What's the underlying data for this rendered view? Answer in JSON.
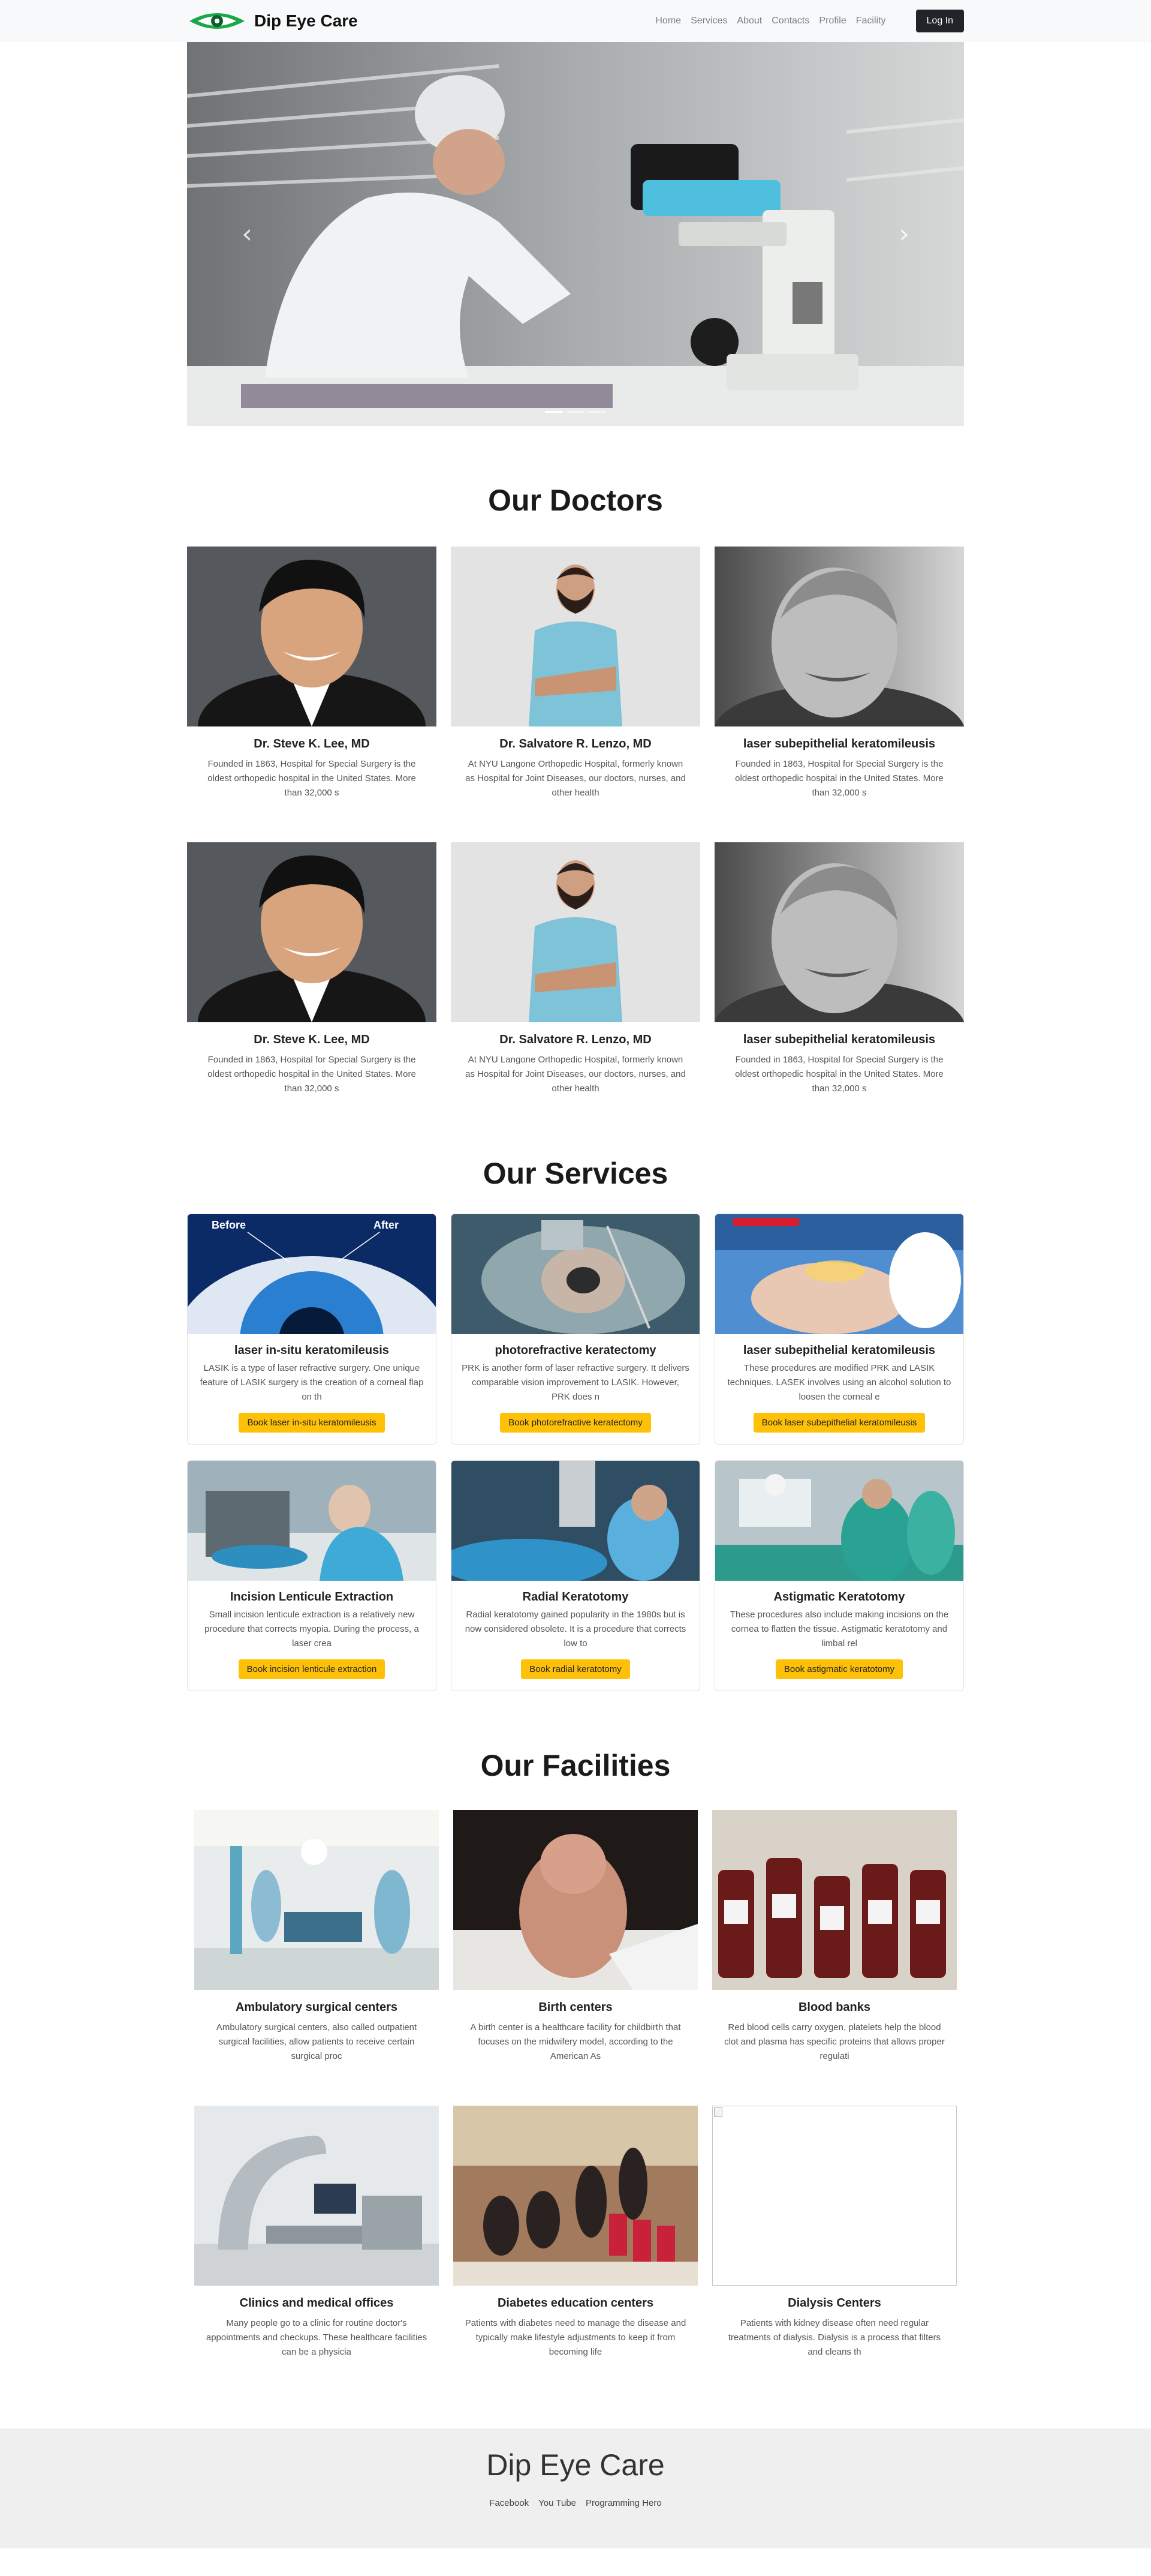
{
  "navbar": {
    "brand": "Dip Eye Care",
    "links": [
      "Home",
      "Services",
      "About",
      "Contacts",
      "Profile",
      "Facility"
    ],
    "login": "Log In"
  },
  "carousel": {
    "prev_icon": "chevron-left-icon",
    "next_icon": "chevron-right-icon",
    "prev_glyph": "‹",
    "next_glyph": "›",
    "slide_count": 3,
    "active_index": 0
  },
  "doctors": {
    "title": "Our Doctors",
    "cards": [
      {
        "name": "Dr. Steve K. Lee, MD",
        "desc": "Founded in 1863, Hospital for Special Surgery is the oldest orthopedic hospital in the United States. More than 32,000 s"
      },
      {
        "name": "Dr. Salvatore R. Lenzo, MD",
        "desc": "At NYU Langone Orthopedic Hospital, formerly known as Hospital for Joint Diseases, our doctors, nurses, and other health"
      },
      {
        "name": "laser subepithelial keratomileusis",
        "desc": "Founded in 1863, Hospital for Special Surgery is the oldest orthopedic hospital in the United States. More than 32,000 s"
      },
      {
        "name": "Dr. Steve K. Lee, MD",
        "desc": "Founded in 1863, Hospital for Special Surgery is the oldest orthopedic hospital in the United States. More than 32,000 s"
      },
      {
        "name": "Dr. Salvatore R. Lenzo, MD",
        "desc": "At NYU Langone Orthopedic Hospital, formerly known as Hospital for Joint Diseases, our doctors, nurses, and other health"
      },
      {
        "name": "laser subepithelial keratomileusis",
        "desc": "Founded in 1863, Hospital for Special Surgery is the oldest orthopedic hospital in the United States. More than 32,000 s"
      }
    ]
  },
  "services": {
    "title": "Our Services",
    "before_label": "Before",
    "after_label": "After",
    "cards": [
      {
        "name": "laser in-situ keratomileusis",
        "desc": "LASIK is a type of laser refractive surgery. One unique feature of LASIK surgery is the creation of a corneal flap on th",
        "button": "Book laser in-situ keratomileusis"
      },
      {
        "name": "photorefractive keratectomy",
        "desc": "PRK is another form of laser refractive surgery. It delivers comparable vision improvement to LASIK. However, PRK does n",
        "button": "Book photorefractive keratectomy"
      },
      {
        "name": "laser subepithelial keratomileusis",
        "desc": "These procedures are modified PRK and LASIK techniques. LASEK involves using an alcohol solution to loosen the corneal e",
        "button": "Book laser subepithelial keratomileusis"
      },
      {
        "name": "Incision Lenticule Extraction",
        "desc": "Small incision lenticule extraction is a relatively new procedure that corrects myopia. During the process, a laser crea",
        "button": "Book incision lenticule extraction"
      },
      {
        "name": "Radial Keratotomy",
        "desc": "Radial keratotomy gained popularity in the 1980s but is now considered obsolete. It is a procedure that corrects low to",
        "button": "Book radial keratotomy"
      },
      {
        "name": "Astigmatic Keratotomy",
        "desc": "These procedures also include making incisions on the cornea to flatten the tissue. Astigmatic keratotomy and limbal rel",
        "button": "Book astigmatic keratotomy"
      }
    ]
  },
  "facilities": {
    "title": "Our Facilities",
    "cards": [
      {
        "name": "Ambulatory surgical centers",
        "desc": "Ambulatory surgical centers, also called outpatient surgical facilities, allow patients to receive certain surgical proc"
      },
      {
        "name": "Birth centers",
        "desc": "A birth center is a healthcare facility for childbirth that focuses on the midwifery model, according to the American As"
      },
      {
        "name": "Blood banks",
        "desc": "Red blood cells carry oxygen, platelets help the blood clot and plasma has specific proteins that allows proper regulati"
      },
      {
        "name": "Clinics and medical offices",
        "desc": "Many people go to a clinic for routine doctor's appointments and checkups. These healthcare facilities can be a physicia"
      },
      {
        "name": "Diabetes education centers",
        "desc": "Patients with diabetes need to manage the disease and typically make lifestyle adjustments to keep it from becoming life"
      },
      {
        "name": "Dialysis Centers",
        "desc": "Patients with kidney disease often need regular treatments of dialysis. Dialysis is a process that filters and cleans th"
      }
    ]
  },
  "footer": {
    "title": "Dip Eye Care",
    "links": [
      "Facebook",
      "You Tube",
      "Programming Hero"
    ]
  },
  "colors": {
    "navbar_bg": "#f8f9fa",
    "login_bg": "#212529",
    "book_button": "#ffc107",
    "footer_bg": "#efefef",
    "logo_green": "#1aa84b"
  }
}
